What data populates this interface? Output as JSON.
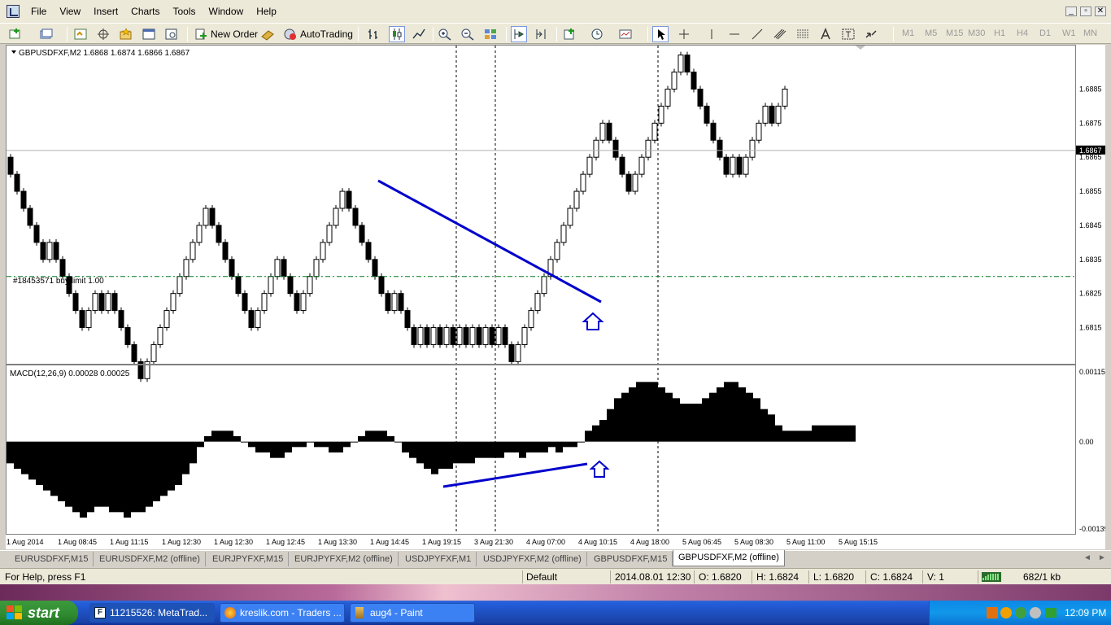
{
  "menu": {
    "items": [
      "File",
      "View",
      "Insert",
      "Charts",
      "Tools",
      "Window",
      "Help"
    ],
    "window_controls": [
      "_",
      "▫",
      "✕"
    ]
  },
  "toolbar": {
    "new_order": "New Order",
    "autotrading": "AutoTrading",
    "timeframes": [
      "M1",
      "M5",
      "M15",
      "M30",
      "H1",
      "H4",
      "D1",
      "W1",
      "MN"
    ]
  },
  "chart": {
    "header": "GBPUSDFXF,M2  1.6868 1.6874 1.6866 1.6867",
    "order_label": "#18453571 buy limit 1.00",
    "current_price": "1.6867",
    "price_ticks": [
      "1.6885",
      "1.6875",
      "1.6865",
      "1.6855",
      "1.6845",
      "1.6835",
      "1.6825",
      "1.6815"
    ],
    "price_range": [
      1.6807,
      1.6893
    ],
    "order_price": 1.683,
    "macd_header": "MACD(12,26,9) 0.00028 0.00025",
    "macd_ticks": [
      "0.00115",
      "0.00",
      "-0.00139"
    ],
    "macd_range": [
      -0.0017,
      0.0013
    ],
    "time_labels": [
      "1 Aug 2014",
      "1 Aug 08:45",
      "1 Aug 11:15",
      "1 Aug 12:30",
      "1 Aug 12:30",
      "1 Aug 12:45",
      "1 Aug 13:30",
      "1 Aug 14:45",
      "1 Aug 19:15",
      "3 Aug 21:30",
      "4 Aug 07:00",
      "4 Aug 10:15",
      "4 Aug 18:00",
      "5 Aug 06:45",
      "5 Aug 08:30",
      "5 Aug 11:00",
      "5 Aug 15:15"
    ],
    "accent": "#0000cc"
  },
  "chart_data": {
    "type": "candlestick",
    "symbol": "GBPUSDFXF,M2",
    "brick_size": 0.0005,
    "directions": [
      -1,
      -1,
      -1,
      -1,
      -1,
      -1,
      1,
      -1,
      -1,
      -1,
      -1,
      -1,
      1,
      1,
      -1,
      1,
      -1,
      -1,
      -1,
      -1,
      -1,
      1,
      1,
      1,
      1,
      1,
      1,
      1,
      1,
      1,
      1,
      -1,
      -1,
      -1,
      -1,
      -1,
      -1,
      -1,
      1,
      1,
      1,
      1,
      -1,
      -1,
      -1,
      1,
      1,
      1,
      1,
      1,
      1,
      1,
      -1,
      -1,
      -1,
      -1,
      -1,
      -1,
      -1,
      1,
      -1,
      -1,
      -1,
      1,
      -1,
      1,
      -1,
      1,
      -1,
      1,
      -1,
      1,
      -1,
      1,
      -1,
      1,
      -1,
      -1,
      1,
      1,
      1,
      1,
      1,
      1,
      1,
      1,
      1,
      1,
      1,
      1,
      1,
      1,
      -1,
      -1,
      -1,
      -1,
      1,
      1,
      1,
      1,
      1,
      1,
      1,
      1,
      -1,
      -1,
      -1,
      -1,
      -1,
      -1,
      -1,
      1,
      -1,
      1,
      1,
      1,
      1,
      -1,
      1,
      1
    ],
    "start_open": 1.6865,
    "macd_histogram": [
      -0.0004,
      -0.0005,
      -0.0006,
      -0.0007,
      -0.0008,
      -0.0009,
      -0.001,
      -0.0011,
      -0.0012,
      -0.0013,
      -0.0014,
      -0.0013,
      -0.0012,
      -0.0012,
      -0.0013,
      -0.0013,
      -0.0014,
      -0.0013,
      -0.0013,
      -0.0012,
      -0.0011,
      -0.001,
      -0.0009,
      -0.0008,
      -0.0006,
      -0.0004,
      -0.0001,
      0.0001,
      0.0002,
      0.0002,
      0.0002,
      0.0001,
      0.0,
      -0.0001,
      -0.0002,
      -0.0002,
      -0.0003,
      -0.0003,
      -0.0002,
      -0.0001,
      -0.0001,
      0.0,
      -0.0001,
      -0.0001,
      -0.0002,
      -0.0002,
      -0.0001,
      0.0,
      0.0001,
      0.0002,
      0.0002,
      0.0002,
      0.0001,
      0.0,
      -0.0002,
      -0.0003,
      -0.0004,
      -0.0005,
      -0.0006,
      -0.0005,
      -0.0005,
      -0.0004,
      -0.0004,
      -0.0004,
      -0.0003,
      -0.0003,
      -0.0003,
      -0.0003,
      -0.0002,
      -0.0002,
      -0.0003,
      -0.0002,
      -0.0002,
      -0.0002,
      -0.0001,
      -0.0002,
      -0.0001,
      -0.0001,
      0.0,
      0.0002,
      0.0003,
      0.0004,
      0.0006,
      0.0008,
      0.0009,
      0.001,
      0.0011,
      0.0011,
      0.0011,
      0.001,
      0.0009,
      0.0008,
      0.0007,
      0.0007,
      0.0007,
      0.0008,
      0.0009,
      0.001,
      0.0011,
      0.0011,
      0.001,
      0.0009,
      0.0008,
      0.0006,
      0.0005,
      0.0003,
      0.0002,
      0.0002,
      0.0002,
      0.0002,
      0.0003,
      0.0003,
      0.0003,
      0.0003,
      0.0003,
      0.0003
    ]
  },
  "tabs": [
    "EURUSDFXF,M15",
    "EURUSDFXF,M2 (offline)",
    "EURJPYFXF,M15",
    "EURJPYFXF,M2 (offline)",
    "USDJPYFXF,M1",
    "USDJPYFXF,M2 (offline)",
    "GBPUSDFXF,M15",
    "GBPUSDFXF,M2 (offline)"
  ],
  "status": {
    "help": "For Help, press F1",
    "profile": "Default",
    "datetime": "2014.08.01 12:30",
    "open": "O: 1.6820",
    "high": "H: 1.6824",
    "low": "L: 1.6820",
    "close": "C: 1.6824",
    "volume": "V: 1",
    "traffic": "682/1 kb"
  },
  "taskbar": {
    "start": "start",
    "buttons": [
      "11215526: MetaTrad...",
      "kreslik.com - Traders ...",
      "aug4 - Paint"
    ],
    "clock": "12:09 PM"
  }
}
